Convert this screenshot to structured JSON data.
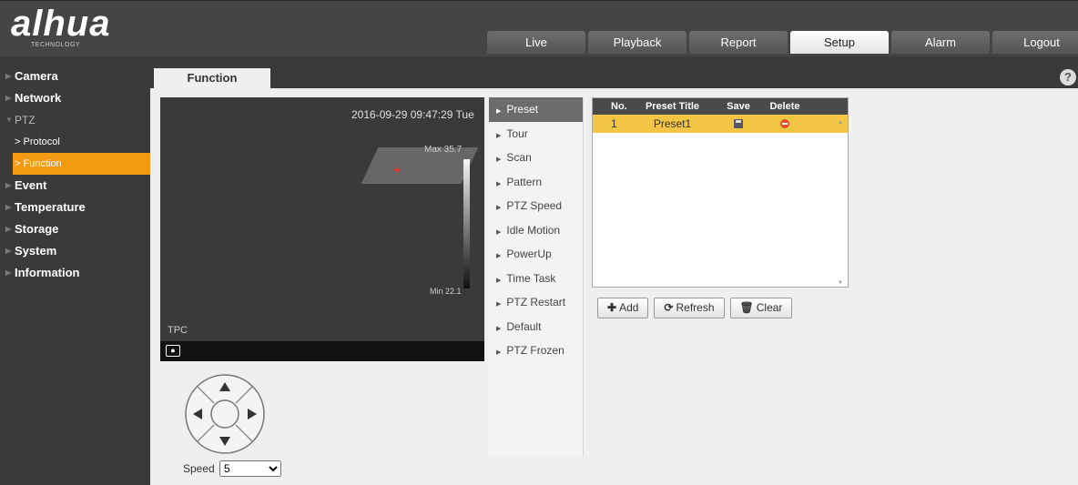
{
  "brand": {
    "logo_text": "alhua",
    "tagline": "TECHNOLOGY"
  },
  "main_tabs": [
    "Live",
    "Playback",
    "Report",
    "Setup",
    "Alarm",
    "Logout"
  ],
  "active_main_tab": "Setup",
  "sidebar": {
    "items": [
      {
        "label": "Camera"
      },
      {
        "label": "Network"
      },
      {
        "label": "PTZ"
      },
      {
        "label": "Protocol"
      },
      {
        "label": "Function"
      },
      {
        "label": "Event"
      },
      {
        "label": "Temperature"
      },
      {
        "label": "Storage"
      },
      {
        "label": "System"
      },
      {
        "label": "Information"
      }
    ],
    "active_sub": "Function"
  },
  "subtab": {
    "label": "Function"
  },
  "help_icon": "?",
  "video": {
    "timestamp": "2016-09-29 09:47:29 Tue",
    "max_temp": "Max 35.7",
    "min_temp": "Min 22.1",
    "label": "TPC"
  },
  "speed": {
    "label": "Speed",
    "value": "5"
  },
  "function_menu": [
    "Preset",
    "Tour",
    "Scan",
    "Pattern",
    "PTZ Speed",
    "Idle Motion",
    "PowerUp",
    "Time Task",
    "PTZ Restart",
    "Default",
    "PTZ Frozen"
  ],
  "active_function": "Preset",
  "preset_table": {
    "headers": {
      "no": "No.",
      "title": "Preset Title",
      "save": "Save",
      "delete": "Delete"
    },
    "rows": [
      {
        "no": "1",
        "title": "Preset1"
      }
    ]
  },
  "buttons": {
    "add": "Add",
    "refresh": "Refresh",
    "clear": "Clear"
  },
  "colors": {
    "accent": "#f39a12",
    "selected_row": "#f3c544",
    "topbar": "#454545",
    "sidebar": "#3a3a3a"
  }
}
